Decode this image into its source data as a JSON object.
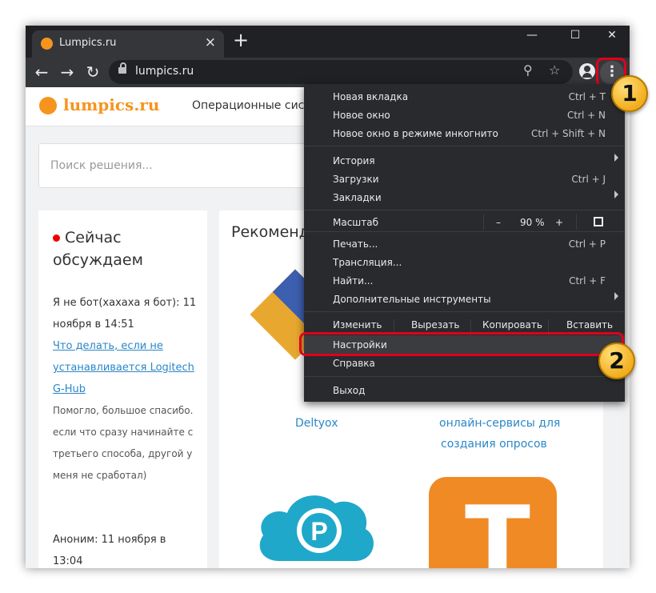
{
  "tab": {
    "title": "Lumpics.ru",
    "close": "×"
  },
  "new_tab": "+",
  "window_controls": {
    "minimize": "—",
    "maximize": "☐",
    "close": "✕"
  },
  "address_bar": {
    "url": "lumpics.ru"
  },
  "nav": {
    "back": "←",
    "forward": "→",
    "reload": "↻"
  },
  "toolbar_icons": {
    "zoom": "⚲",
    "star": "☆",
    "menu": "⋮"
  },
  "site": {
    "logo_text": "lumpics.ru",
    "nav_item": "Операционные сист",
    "search_placeholder": "Поиск решения...",
    "discuss_title": "Сейчас обсуждаем",
    "comment1_author": "Я не бот(хахаха я бот): 11 ноября в 14:51",
    "comment1_link": "Что делать, если не устанавливается Logitech G-Hub",
    "comment1_text": "Помогло, большое спасибо. если что сразу начинайте с третьего способа, другой у меня не сработал)",
    "comment2_author": "Аноним: 11 ноября в 13:04",
    "recommend_title": "Рекоменд",
    "caption1": "Deltyox",
    "caption2": "онлайн-сервисы для",
    "caption3": "создания опросов",
    "tile_letter": "T",
    "cloud_letter": "P"
  },
  "menu": {
    "group1": [
      {
        "label": "Новая вкладка",
        "shortcut": "Ctrl + T"
      },
      {
        "label": "Новое окно",
        "shortcut": "Ctrl + N"
      },
      {
        "label": "Новое окно в режиме инкогнито",
        "shortcut": "Ctrl + Shift + N"
      }
    ],
    "group2": [
      {
        "label": "История",
        "shortcut": ""
      },
      {
        "label": "Загрузки",
        "shortcut": "Ctrl + J"
      },
      {
        "label": "Закладки",
        "shortcut": ""
      }
    ],
    "zoom": {
      "label": "Масштаб",
      "minus": "–",
      "value": "90 %",
      "plus": "+"
    },
    "group3": [
      {
        "label": "Печать...",
        "shortcut": "Ctrl + P"
      },
      {
        "label": "Трансляция...",
        "shortcut": ""
      },
      {
        "label": "Найти...",
        "shortcut": "Ctrl + F"
      },
      {
        "label": "Дополнительные инструменты",
        "shortcut": ""
      }
    ],
    "edit": {
      "label": "Изменить",
      "cut": "Вырезать",
      "copy": "Копировать",
      "paste": "Вставить"
    },
    "settings": "Настройки",
    "help": "Справка",
    "exit": "Выход"
  },
  "annotations": {
    "badge1": "1",
    "badge2": "2",
    "highlight_color": "#e0001b",
    "badge_color": "#f2ae1e"
  }
}
